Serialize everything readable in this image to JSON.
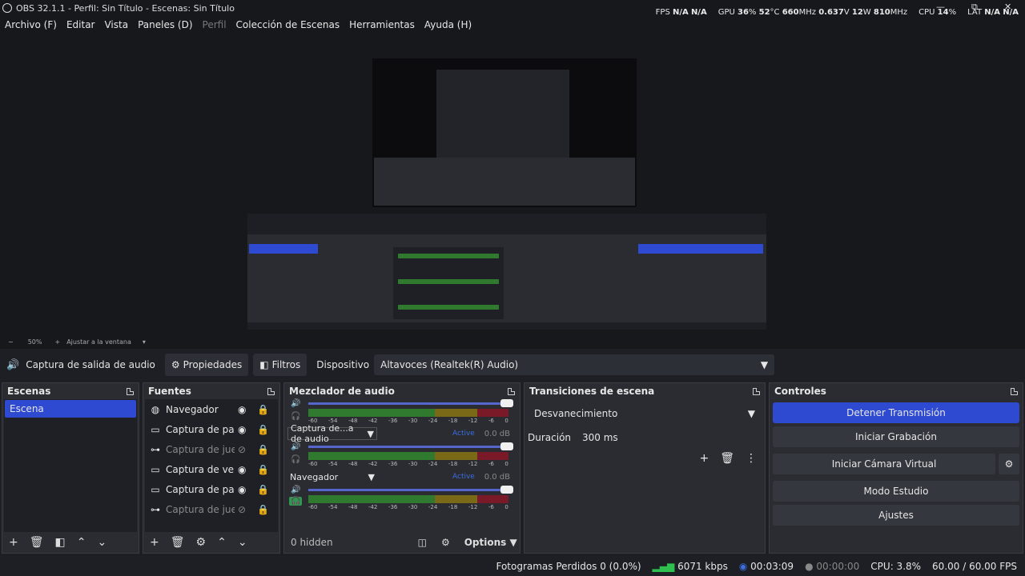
{
  "window": {
    "title": "OBS 32.1.1 - Perfil: Sin Título - Escenas: Sin Título",
    "min": "—",
    "max": "⧉",
    "close": "✕"
  },
  "menu": [
    "Archivo (F)",
    "Editar",
    "Vista",
    "Paneles (D)",
    "Perfil",
    "Colección de Escenas",
    "Herramientas",
    "Ayuda (H)"
  ],
  "perf": {
    "fps_label": "FPS",
    "fps_a": "N/A",
    "fps_b": "N/A",
    "gpu_label": "GPU",
    "gpu_pct": "36",
    "gpu_temp": "52",
    "gpu_clock": "660",
    "gpu_volt": "0.637",
    "gpu_watt": "12",
    "gpu_mem": "810",
    "cpu_label": "CPU",
    "cpu_pct": "14",
    "lat_label": "LAT",
    "lat_a": "N/A",
    "lat_b": "N/A",
    "pct": "%",
    "deg": "°C",
    "mhz": "MHz",
    "v": "V",
    "w": "W"
  },
  "zoom": {
    "minus": "−",
    "level": "50%",
    "plus": "+",
    "fit": "Ajustar a la ventana"
  },
  "context": {
    "source": "Captura de salida de audio",
    "properties": "Propiedades",
    "filters": "Filtros",
    "device_label": "Dispositivo",
    "device_value": "Altavoces (Realtek(R) Audio)"
  },
  "scenes": {
    "title": "Escenas",
    "items": [
      "Escena"
    ]
  },
  "sources": {
    "title": "Fuentes",
    "items": [
      {
        "name": "Navegador",
        "icon": "globe-icon",
        "visible": true
      },
      {
        "name": "Captura de pantalla",
        "icon": "monitor-icon",
        "visible": true
      },
      {
        "name": "Captura de juego",
        "icon": "gamepad-icon",
        "visible": false
      },
      {
        "name": "Captura de ventana",
        "icon": "window-icon",
        "visible": true
      },
      {
        "name": "Captura de pantalla",
        "icon": "monitor-icon",
        "visible": true
      },
      {
        "name": "Captura de juego",
        "icon": "gamepad-icon",
        "visible": false
      }
    ]
  },
  "mixer": {
    "title": "Mezclador de audio",
    "tracks": [
      {
        "name": "Captura de...a de audio",
        "status": "Active",
        "db": "0.0 dB"
      },
      {
        "name": "Navegador",
        "status": "Active",
        "db": "0.0 dB"
      }
    ],
    "scale": [
      "-60",
      "-54",
      "-48",
      "-42",
      "-36",
      "-30",
      "-24",
      "-18",
      "-12",
      "-6",
      "0"
    ],
    "hidden": "0 hidden",
    "options": "Options"
  },
  "transitions": {
    "title": "Transiciones de escena",
    "selected": "Desvanecimiento",
    "duration_label": "Duración",
    "duration_value": "300 ms"
  },
  "controls": {
    "title": "Controles",
    "stop_stream": "Detener Transmisión",
    "start_recording": "Iniciar Grabación",
    "start_virtual_cam": "Iniciar Cámara Virtual",
    "studio_mode": "Modo Estudio",
    "settings": "Ajustes"
  },
  "status": {
    "dropped": "Fotogramas Perdidos 0 (0.0%)",
    "bitrate": "6071 kbps",
    "stream_time": "00:03:09",
    "rec_time": "00:00:00",
    "cpu": "CPU: 3.8%",
    "fps": "60.00 / 60.00 FPS"
  },
  "colors": {
    "accent": "#2e4ad0",
    "active": "#3b6ee0"
  }
}
